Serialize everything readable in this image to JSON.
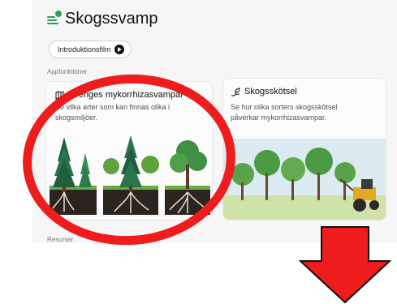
{
  "app": {
    "title": "Skogssvamp"
  },
  "intro_button": {
    "label": "Introduktionsfilm"
  },
  "sections": {
    "apps_label": "Appfunktioner",
    "resources_label": "Resurser"
  },
  "cards": [
    {
      "title": "Sveriges mykorrhizasvampar",
      "desc_line1": "Se vilka arter som kan finnas olika i",
      "desc_line2": "skogsmiljöer.",
      "icon": "map-icon"
    },
    {
      "title": "Skogsskötsel",
      "desc_line1": "Se hur olika sorters skogsskötsel",
      "desc_line2": "påverkar mykorrhizasvampar.",
      "icon": "plant-hand-icon"
    }
  ],
  "annotations": {
    "circle_color": "#ee1c1c",
    "arrow_color": "#ee1c1c"
  },
  "colors": {
    "accent": "#2f9d57"
  }
}
